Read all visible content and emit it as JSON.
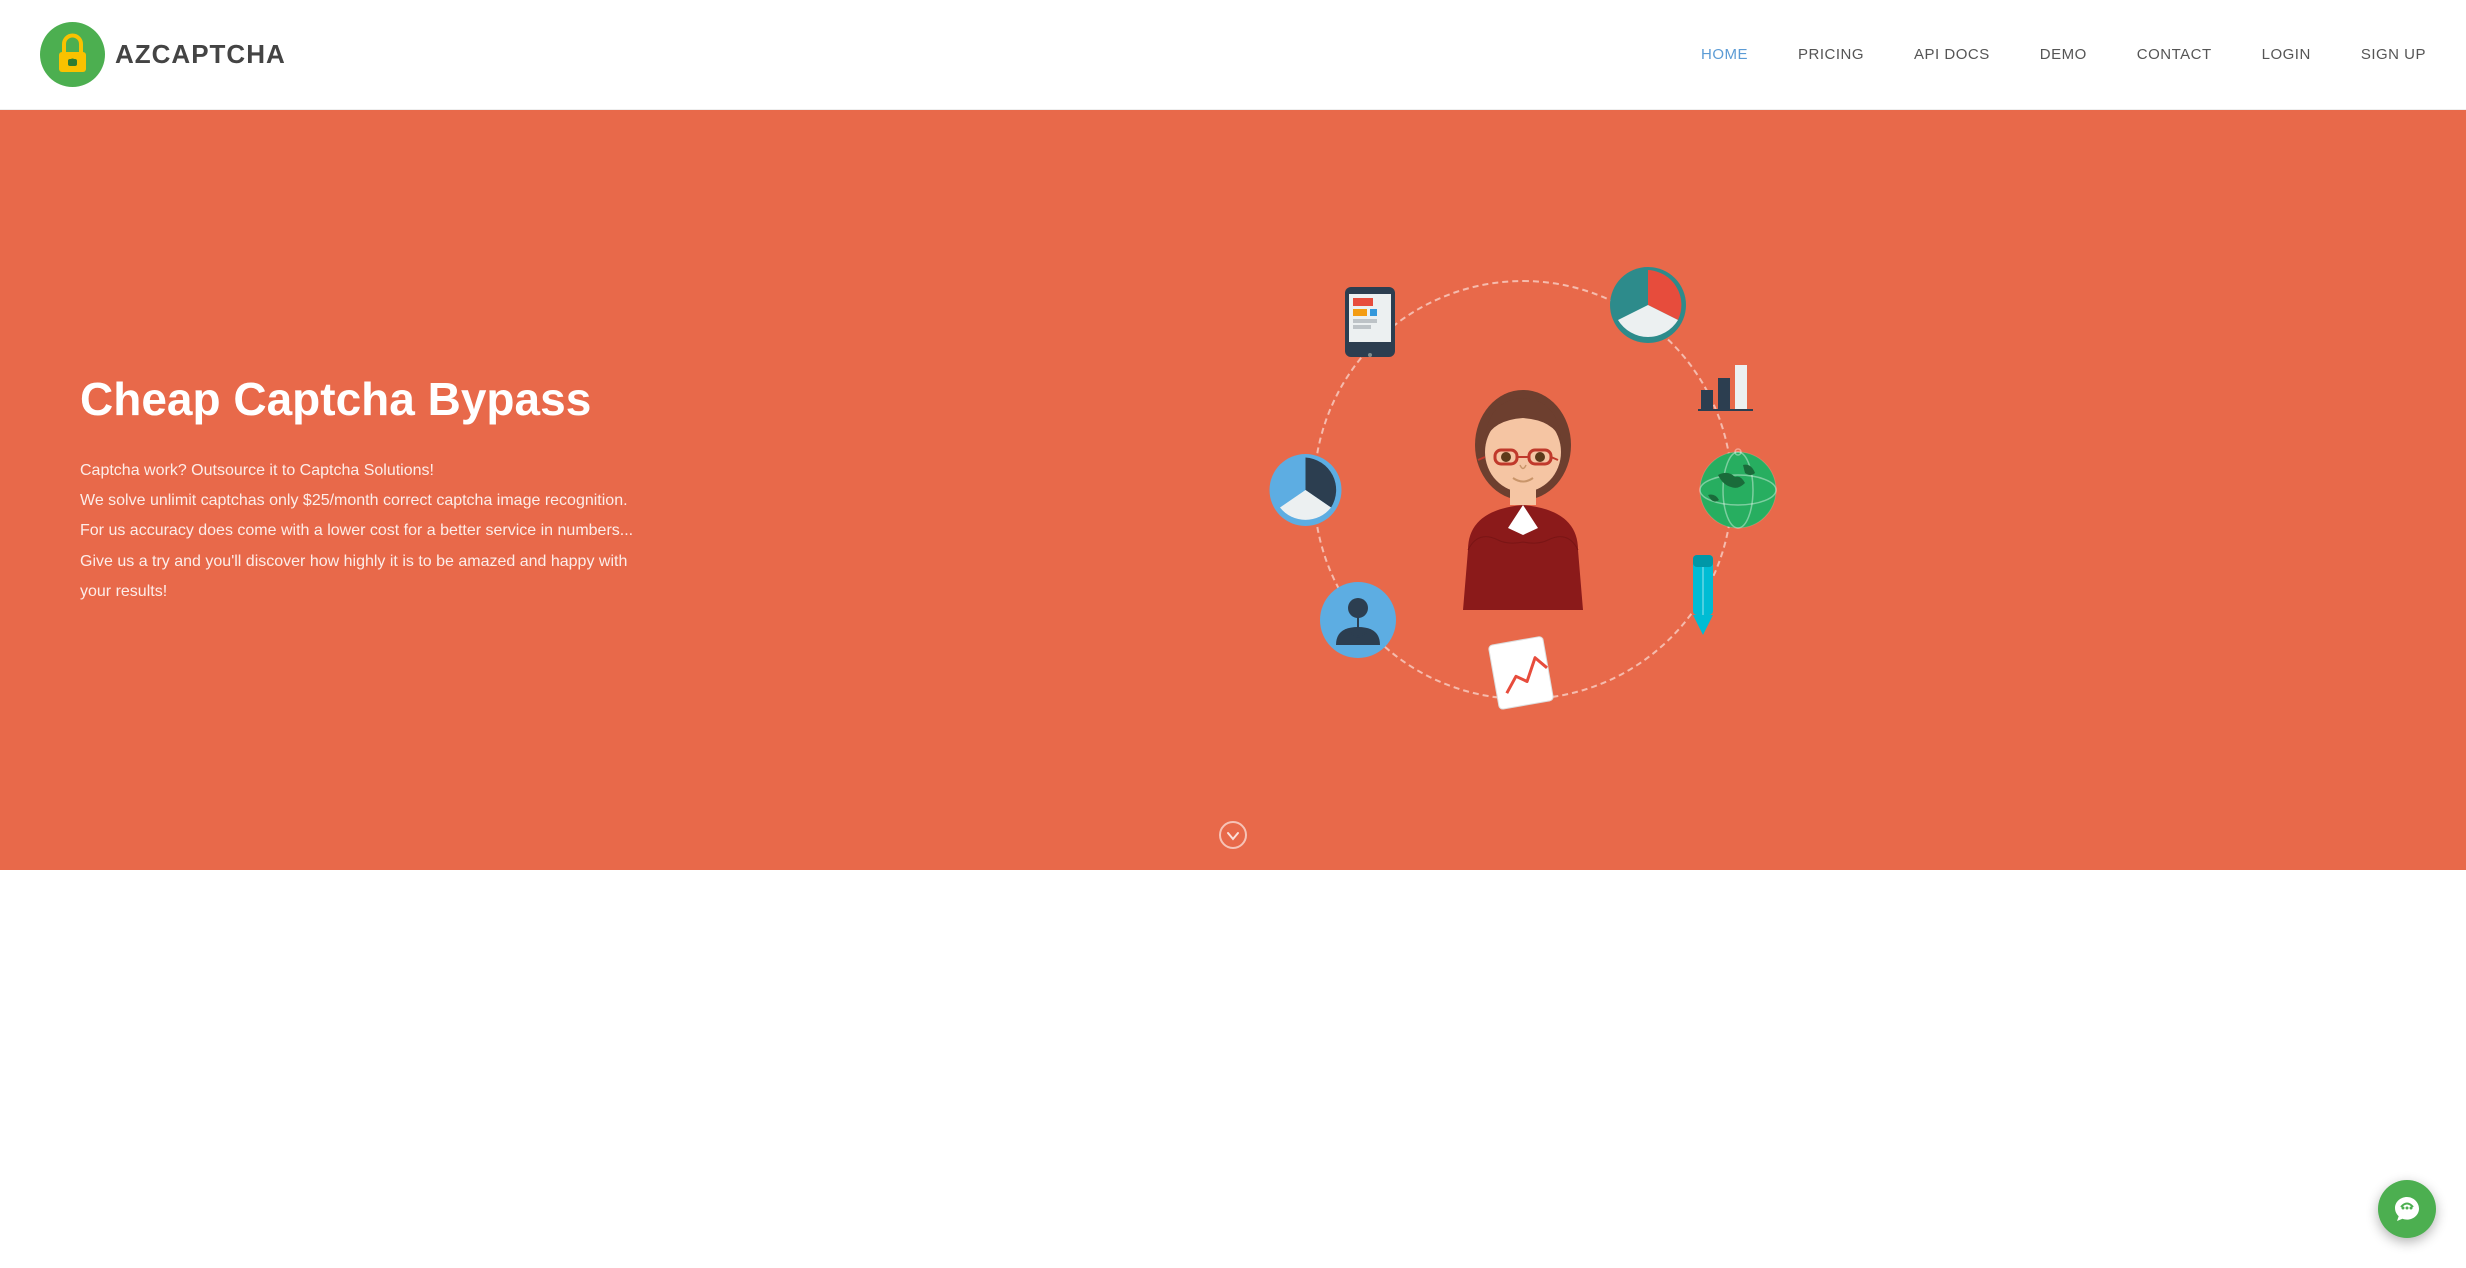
{
  "navbar": {
    "logo_text": "AZCAPTCHA",
    "links": [
      {
        "label": "HOME",
        "active": true,
        "id": "home"
      },
      {
        "label": "PRICING",
        "active": false,
        "id": "pricing"
      },
      {
        "label": "API DOCS",
        "active": false,
        "id": "api-docs"
      },
      {
        "label": "DEMO",
        "active": false,
        "id": "demo"
      },
      {
        "label": "CONTACT",
        "active": false,
        "id": "contact"
      },
      {
        "label": "LOGIN",
        "active": false,
        "id": "login"
      },
      {
        "label": "SIGN UP",
        "active": false,
        "id": "signup"
      }
    ]
  },
  "hero": {
    "title": "Cheap Captcha Bypass",
    "description_lines": [
      "Captcha work? Outsource it to Captcha Solutions!",
      "We solve unlimit captchas only $25/month correct captcha image recognition.",
      "For us accuracy does come with a lower cost for a better service in numbers...",
      "Give us a try and you'll discover how highly it is to be amazed and happy with your results!"
    ],
    "bg_color": "#e8694a"
  },
  "chat_button": {
    "label": "chat-icon"
  }
}
